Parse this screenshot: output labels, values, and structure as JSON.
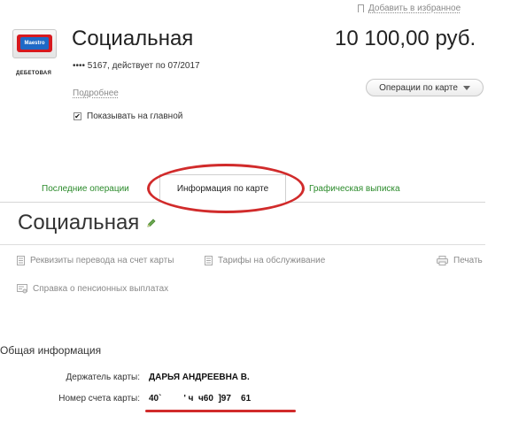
{
  "favorites": {
    "label": "Добавить в избранное",
    "icon": "bookmark-icon"
  },
  "card": {
    "brand": "Maestro",
    "type_badge": "ДЕБЕТОВАЯ",
    "title": "Социальная",
    "info": "•••• 5167, действует по 07/2017",
    "details_link": "Подробнее",
    "show_on_main_label": "Показывать на главной",
    "show_on_main_checked": true,
    "balance": "10 100,00 руб.",
    "operations_button": "Операции по карте"
  },
  "tabs": [
    {
      "label": "Последние операции",
      "active": false
    },
    {
      "label": "Информация по карте",
      "active": true
    },
    {
      "label": "Графическая выписка",
      "active": false
    }
  ],
  "info_page": {
    "title": "Социальная",
    "links": {
      "transfer_details": "Реквизиты перевода на счет карты",
      "tariffs": "Тарифы на обслуживание",
      "print": "Печать",
      "pension_certificate": "Справка о пенсионных выплатах"
    },
    "general_section": {
      "heading": "Общая информация",
      "rows": [
        {
          "label": "Держатель карты:",
          "value": "ДАРЬЯ АНДРЕЕВНА В."
        },
        {
          "label": "Номер счета карты:",
          "value": "40`         ' ч  ч60  ]97    61"
        }
      ]
    }
  },
  "colors": {
    "accent_green": "#2a8a2a",
    "annotation_red": "#d12b2b",
    "maestro_red": "#d7191f",
    "maestro_blue": "#1e69c6"
  }
}
